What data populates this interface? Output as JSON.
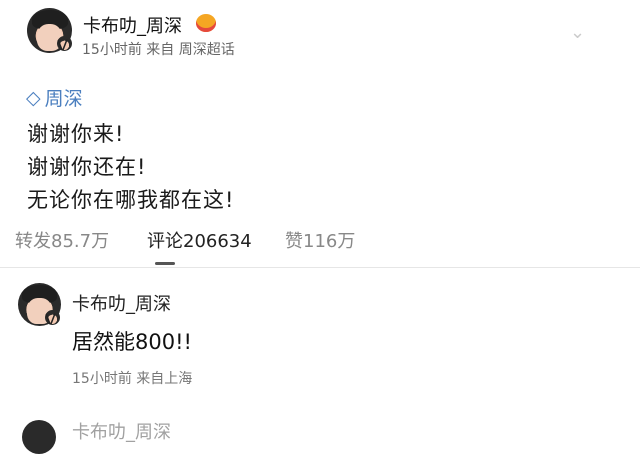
{
  "post": {
    "author": "卡布叻_周深",
    "meta": "15小时前 来自 周深超话",
    "topic": "周深",
    "lines": [
      "谢谢你来!",
      "谢谢你还在!",
      "无论你在哪我都在这!"
    ]
  },
  "tabs": [
    {
      "label": "转发85.7万"
    },
    {
      "label": "评论206634"
    },
    {
      "label": "赞116万"
    }
  ],
  "comment": {
    "author": "卡布叻_周深",
    "text": "居然能800!!",
    "meta": "15小时前 来自上海"
  },
  "next_comment": {
    "author": "卡布叻_周深"
  },
  "colors": {
    "topic": "#4b7fbf",
    "badge": "#f39c12"
  },
  "icons": {
    "vip": "crown-icon",
    "topic": "diamond-icon",
    "verified": "verified-badge-icon"
  }
}
